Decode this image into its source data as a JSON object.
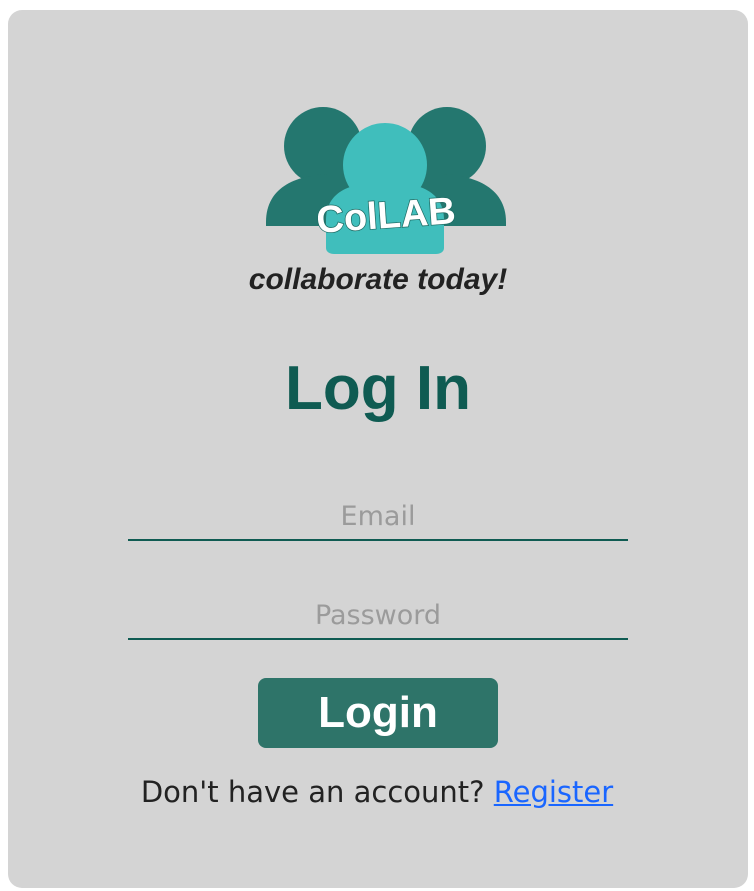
{
  "brand": {
    "logo_text": "ColLAB",
    "tagline": "collaborate today!",
    "colors": {
      "people_dark": "#24776f",
      "people_light": "#40bebc"
    }
  },
  "page": {
    "title": "Log In"
  },
  "form": {
    "email_placeholder": "Email",
    "password_placeholder": "Password",
    "email_value": "",
    "password_value": "",
    "login_label": "Login"
  },
  "footer": {
    "prompt": "Don't have an account? ",
    "register_label": "Register"
  },
  "colors": {
    "card_bg": "#d4d4d4",
    "accent": "#0f5b52",
    "button_bg": "#2e7469",
    "link": "#1a66ff"
  }
}
